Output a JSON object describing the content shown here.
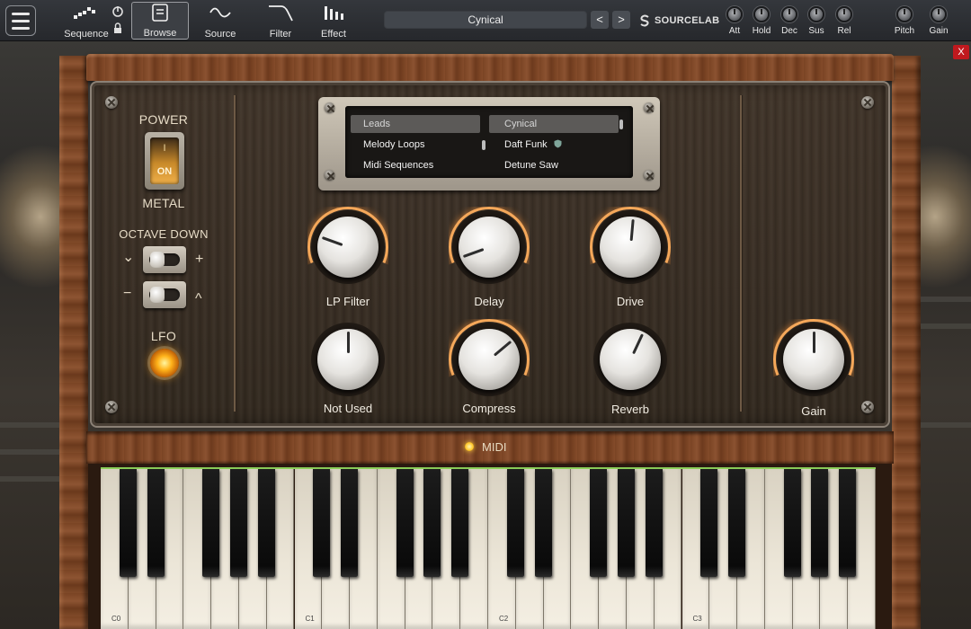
{
  "toolbar": {
    "nav": [
      {
        "label": "Sequence",
        "icon": "sequence-icon"
      },
      {
        "label": "Browse",
        "icon": "browse-icon",
        "active": true
      },
      {
        "label": "Source",
        "icon": "source-wave-icon"
      },
      {
        "label": "Filter",
        "icon": "filter-curve-icon"
      },
      {
        "label": "Effect",
        "icon": "effect-bars-icon"
      }
    ],
    "preset_name": "Cynical",
    "prev_arrow": "<",
    "next_arrow": ">",
    "brand": "SOURCELAB",
    "envelope_knobs": [
      "Att",
      "Hold",
      "Dec",
      "Sus",
      "Rel"
    ],
    "master_knobs": [
      "Pitch",
      "Gain"
    ],
    "close_label": "X"
  },
  "panel": {
    "power_label": "POWER",
    "power_switch_top": "I",
    "power_switch_state": "ON",
    "metal_label": "METAL",
    "octave_label": "OCTAVE DOWN",
    "octave_row1_left": "⌄",
    "octave_row1_right": "+",
    "octave_row2_left": "−",
    "octave_row2_right": "^",
    "lfo_label": "LFO"
  },
  "browser": {
    "categories": [
      "Leads",
      "Melody Loops",
      "Midi Sequences"
    ],
    "selected_category": "Leads",
    "presets": [
      "Cynical",
      "Daft Funk",
      "Detune Saw"
    ],
    "selected_preset": "Cynical"
  },
  "knobs": [
    {
      "label": "LP Filter",
      "angle": -70
    },
    {
      "label": "Delay",
      "angle": -110
    },
    {
      "label": "Drive",
      "angle": 5
    },
    {
      "label": "Not Used",
      "angle": 0
    },
    {
      "label": "Compress",
      "angle": 50
    },
    {
      "label": "Reverb",
      "angle": 25
    },
    {
      "label": "Gain",
      "angle": 0
    }
  ],
  "midi_label": "MIDI",
  "keyboard": {
    "octave_labels": [
      "C0",
      "C1",
      "C2",
      "C3"
    ]
  },
  "colors": {
    "accent_glow": "#f5a85a",
    "led_yellow": "#ffc62a",
    "close_red": "#c0191e"
  }
}
